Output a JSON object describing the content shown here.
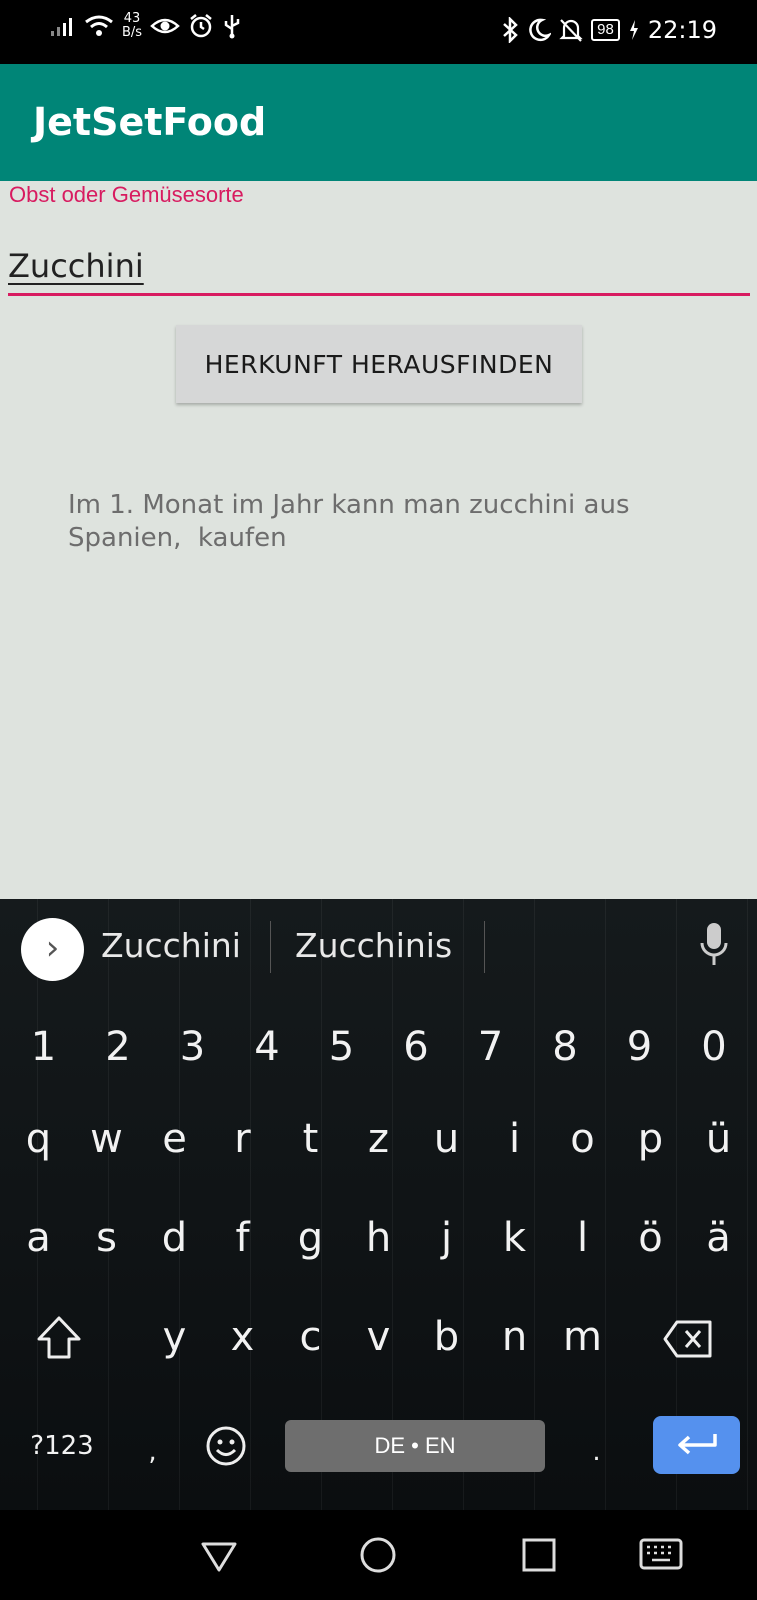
{
  "status_bar": {
    "net_speed_value": "43",
    "net_speed_unit": "B/s",
    "battery": "98",
    "time": "22:19"
  },
  "app": {
    "title": "JetSetFood"
  },
  "form": {
    "label": "Obst oder Gemüsesorte",
    "value": "Zucchini",
    "button_label": "HERKUNFT HERAUSFINDEN"
  },
  "result": {
    "line1": "Im 1. Monat im Jahr kann man zucchini aus",
    "line2": "Spanien,  kaufen"
  },
  "keyboard": {
    "suggestions": [
      "Zucchini",
      "Zucchinis"
    ],
    "numbers": [
      "1",
      "2",
      "3",
      "4",
      "5",
      "6",
      "7",
      "8",
      "9",
      "0"
    ],
    "row1": [
      "q",
      "w",
      "e",
      "r",
      "t",
      "z",
      "u",
      "i",
      "o",
      "p",
      "ü"
    ],
    "row2": [
      "a",
      "s",
      "d",
      "f",
      "g",
      "h",
      "j",
      "k",
      "l",
      "ö",
      "ä"
    ],
    "row3": [
      "y",
      "x",
      "c",
      "v",
      "b",
      "n",
      "m"
    ],
    "symbols_label": "?123",
    "comma": ",",
    "period": ".",
    "space_label": "DE • EN"
  },
  "colors": {
    "app_bar": "#008577",
    "accent": "#d81b60",
    "content_bg": "#dee3de",
    "enter_key": "#5591ee"
  }
}
